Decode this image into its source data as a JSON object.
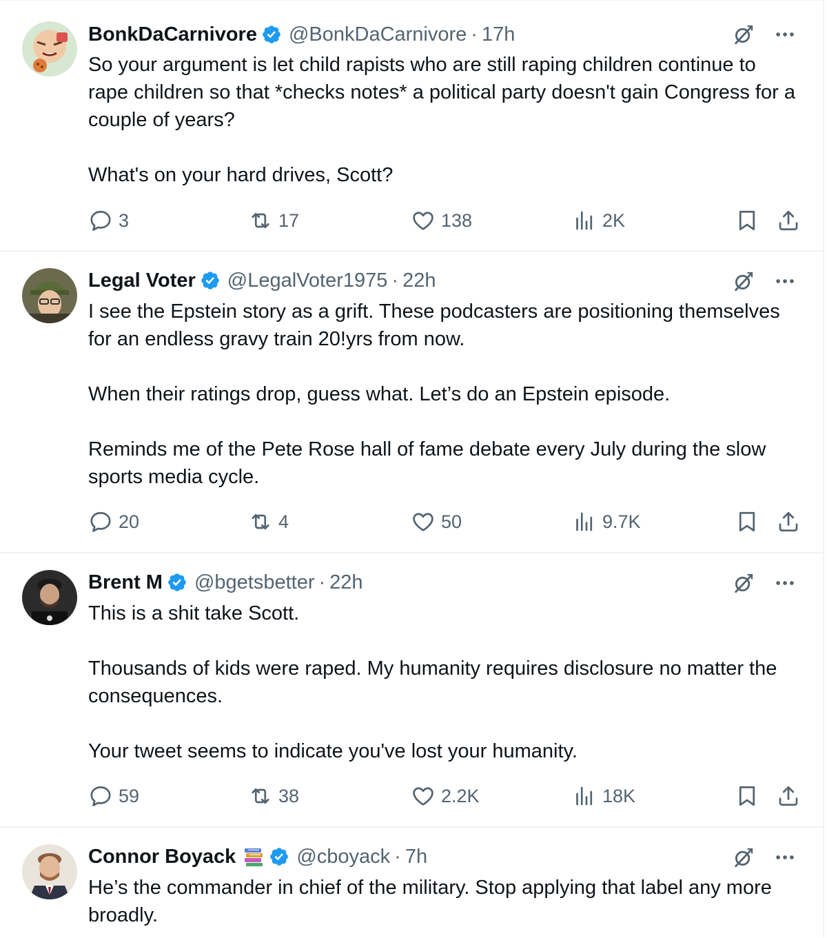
{
  "tweets": [
    {
      "name": "BonkDaCarnivore",
      "handle": "@BonkDaCarnivore",
      "sep": "·",
      "time": "17h",
      "paragraphs": [
        "So your argument is let child rapists who are still raping children continue to rape children so that *checks notes* a political party doesn't gain Congress for a couple of years?",
        "What's on your hard drives, Scott?"
      ],
      "replies": "3",
      "reposts": "17",
      "likes": "138",
      "views": "2K"
    },
    {
      "name": "Legal Voter",
      "handle": "@LegalVoter1975",
      "sep": "·",
      "time": "22h",
      "paragraphs": [
        "I see the Epstein story as a grift.  These podcasters are positioning themselves for an endless gravy train 20!yrs from now.",
        "When their ratings drop, guess what.  Let’s do an Epstein episode.",
        "Reminds me of the Pete Rose hall of fame debate every July during the slow sports media cycle."
      ],
      "replies": "20",
      "reposts": "4",
      "likes": "50",
      "views": "9.7K"
    },
    {
      "name": "Brent M",
      "handle": "@bgetsbetter",
      "sep": "·",
      "time": "22h",
      "paragraphs": [
        "This is a shit take Scott.",
        "Thousands of kids were raped. My humanity requires disclosure no matter the consequences.",
        "Your tweet seems to indicate you've lost your humanity."
      ],
      "replies": "59",
      "reposts": "38",
      "likes": "2.2K",
      "views": "18K"
    },
    {
      "name": "Connor Boyack",
      "handle": "@cboyack",
      "sep": "·",
      "time": "7h",
      "paragraphs": [
        "He’s the commander in chief of the military. Stop applying that label any more broadly."
      ]
    }
  ],
  "colors": {
    "text": "#0f1419",
    "muted": "#536471",
    "verified": "#1d9bf0",
    "divider": "#eff3f4"
  },
  "icons": [
    "verified-badge-icon",
    "grok-icon",
    "more-icon",
    "reply-icon",
    "repost-icon",
    "like-icon",
    "views-icon",
    "bookmark-icon",
    "share-icon",
    "books-emoji-icon"
  ]
}
